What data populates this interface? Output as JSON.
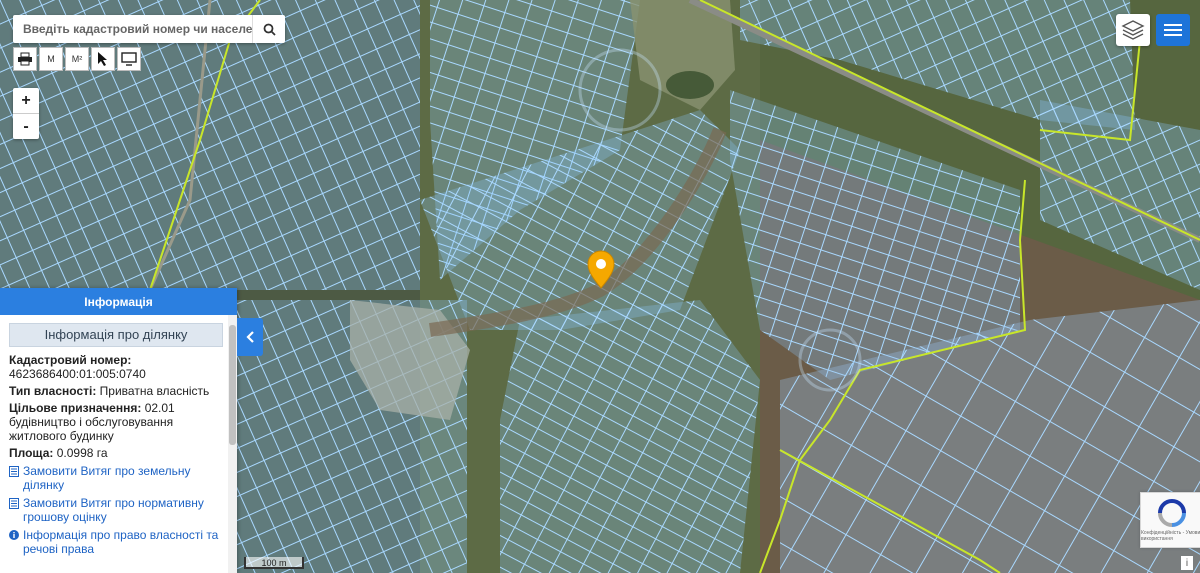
{
  "search": {
    "placeholder": "Введіть кадастровий номер чи населений"
  },
  "toolbar": {
    "print_icon": "printer-icon",
    "measure_line_label": "M",
    "measure_area_label": "M²",
    "select_icon": "cursor-icon",
    "screen_icon": "screen-icon"
  },
  "zoom": {
    "in": "+",
    "out": "-"
  },
  "panel": {
    "header": "Інформація",
    "subheader": "Інформація про ділянку",
    "cadastral_label": "Кадастровий номер:",
    "cadastral_value": "4623686400:01:005:0740",
    "ownership_label": "Тип власності:",
    "ownership_value": "Приватна власність",
    "purpose_label": "Цільове призначення:",
    "purpose_value": "02.01 будівництво і обслуговування житлового будинку",
    "area_label": "Площа:",
    "area_value": "0.0998 га",
    "links": [
      "Замовити Витяг про земельну ділянку",
      "Замовити Витяг про нормативну грошову оцінку",
      "Інформація про право власності та речові права"
    ]
  },
  "scale": {
    "label": "100 m"
  },
  "recaptcha": {
    "caption": "Конфіденційність - Умови використання"
  },
  "info_button": "i",
  "colors": {
    "accent": "#2b7fe0",
    "parcel_outline": "#9fd4ff",
    "boundary_line": "#c8e62a",
    "marker": "#f5a800"
  }
}
